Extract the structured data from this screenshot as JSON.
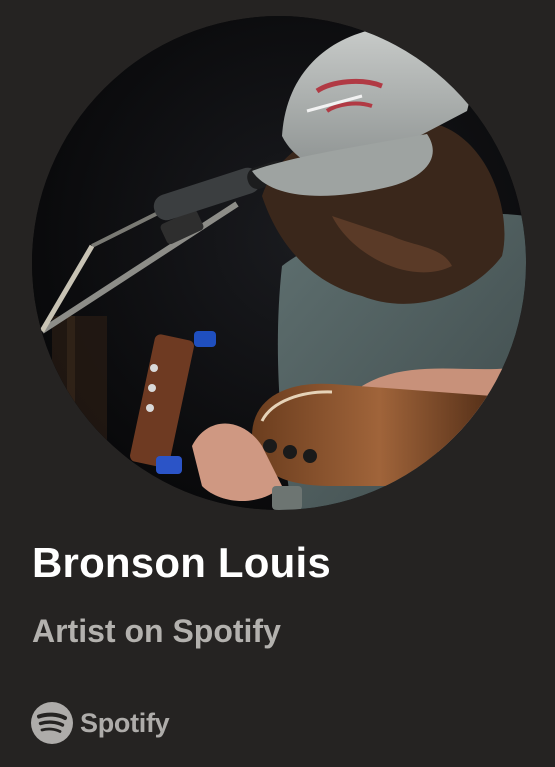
{
  "artist": {
    "name": "Bronson Louis",
    "subtitle": "Artist on Spotify"
  },
  "brand": {
    "icon": "spotify-logo-icon",
    "wordmark": "Spotify"
  },
  "colors": {
    "background": "#252322",
    "name_text": "#ffffff",
    "subtitle_text": "#b3b1ae",
    "brand_text": "#aeacaa"
  }
}
